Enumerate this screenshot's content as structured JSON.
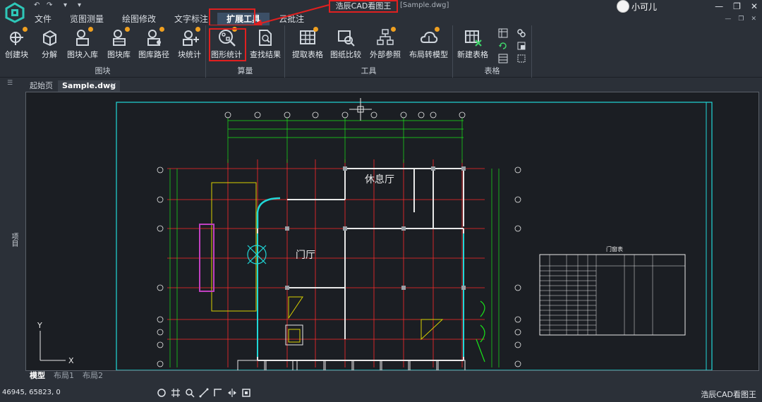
{
  "quick_access": {
    "undo": "↶",
    "redo": "↷",
    "more": "▾"
  },
  "menu": [
    "文件",
    "览图测量",
    "绘图修改",
    "文字标注",
    "扩展工具",
    "云批注"
  ],
  "active_menu": "扩展工具",
  "window": {
    "app_title": "浩辰CAD看图王",
    "file": "[Sample.dwg]"
  },
  "user": {
    "name": "小可儿"
  },
  "window_buttons": {
    "minimize": "—",
    "restore": "❐",
    "close": "✕"
  },
  "sub_window_buttons": {
    "minimize": "—",
    "restore": "❐",
    "close": "✕"
  },
  "ribbon": {
    "groups": [
      {
        "label": "图块",
        "items": [
          "创建块",
          "分解",
          "图块入库",
          "图块库",
          "图库路径",
          "块统计"
        ]
      },
      {
        "label": "算量",
        "items": [
          "图形统计",
          "查找结果"
        ]
      },
      {
        "label": "工具",
        "items": [
          "提取表格",
          "图纸比较",
          "外部参照",
          "布局转模型"
        ]
      },
      {
        "label": "表格",
        "items": [
          "新建表格"
        ]
      }
    ]
  },
  "tabs": {
    "start": "起始页",
    "file": "Sample.dwg",
    "close": "✕"
  },
  "sidebar_label": "项目",
  "drawing": {
    "rooms": [
      "休息厅",
      "门厅"
    ],
    "table_title": "门窗表",
    "axis_y": "Y",
    "axis_x": "X"
  },
  "layouts": [
    "模型",
    "布局1",
    "布局2"
  ],
  "status": {
    "coords": "46945, 65823, 0",
    "brand": "浩辰CAD看图王"
  },
  "colors": {
    "accent": "#3c4f66",
    "highlight": "#e02020",
    "badge": "#f0a020",
    "cad_red": "#ff2a2a",
    "cad_white": "#e8e8e8",
    "cad_green": "#19e619",
    "cad_cyan": "#20d8d8",
    "cad_yellow": "#d8d000"
  }
}
